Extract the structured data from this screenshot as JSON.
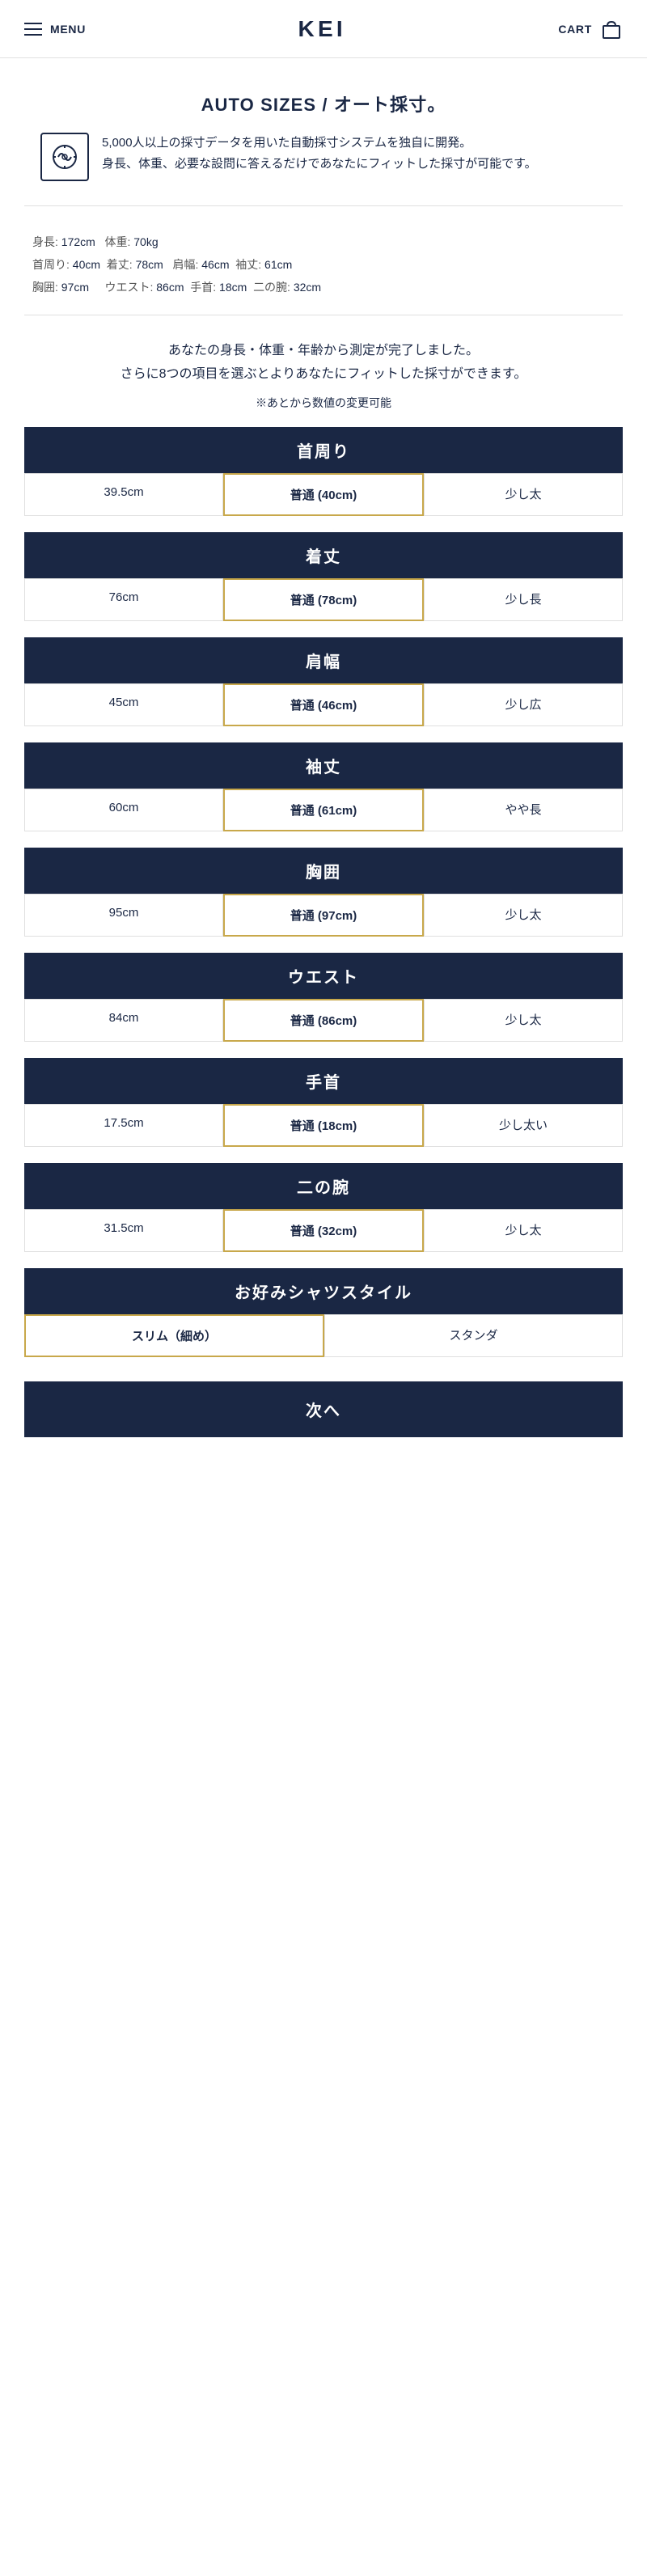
{
  "header": {
    "menu_label": "MENU",
    "logo": "KEI",
    "cart_label": "CART"
  },
  "auto_sizes": {
    "title": "AUTO SIZES / オート採寸。",
    "description_line1": "5,000人以上の採寸データを用いた自動採寸システムを独自に開発。",
    "description_line2": "身長、体重、必要な設問に答えるだけであなたにフィットした採寸が可能です。"
  },
  "measurements": {
    "rows": [
      [
        {
          "label": "身長:",
          "value": "172cm"
        },
        {
          "label": "体重:",
          "value": "70kg"
        }
      ],
      [
        {
          "label": "首周り:",
          "value": "40cm"
        },
        {
          "label": "着丈:",
          "value": "78cm"
        },
        {
          "label": "肩幅:",
          "value": "46cm"
        },
        {
          "label": "袖丈:",
          "value": "61cm"
        }
      ],
      [
        {
          "label": "胸囲:",
          "value": "97cm"
        },
        {
          "label": "ウエスト:",
          "value": "86cm"
        },
        {
          "label": "手首:",
          "value": "18cm"
        },
        {
          "label": "二の腕:",
          "value": "32cm"
        }
      ]
    ]
  },
  "intro": {
    "line1": "あなたの身長・体重・年齢から測定が完了しました。",
    "line2": "さらに8つの項目を選ぶとよりあなたにフィットした採寸ができます。",
    "note": "※あとから数値の変更可能"
  },
  "selectors": [
    {
      "id": "neck",
      "label": "首周り",
      "options": [
        {
          "text": "39.5cm",
          "selected": false
        },
        {
          "text": "普通 (40cm)",
          "selected": true
        },
        {
          "text": "少し太",
          "selected": false
        }
      ]
    },
    {
      "id": "length",
      "label": "着丈",
      "options": [
        {
          "text": "76cm",
          "selected": false
        },
        {
          "text": "普通 (78cm)",
          "selected": true
        },
        {
          "text": "少し長",
          "selected": false
        }
      ]
    },
    {
      "id": "shoulder",
      "label": "肩幅",
      "options": [
        {
          "text": "45cm",
          "selected": false
        },
        {
          "text": "普通 (46cm)",
          "selected": true
        },
        {
          "text": "少し広",
          "selected": false
        }
      ]
    },
    {
      "id": "sleeve",
      "label": "袖丈",
      "options": [
        {
          "text": "60cm",
          "selected": false
        },
        {
          "text": "普通 (61cm)",
          "selected": true
        },
        {
          "text": "やや長",
          "selected": false
        }
      ]
    },
    {
      "id": "chest",
      "label": "胸囲",
      "options": [
        {
          "text": "95cm",
          "selected": false
        },
        {
          "text": "普通 (97cm)",
          "selected": true
        },
        {
          "text": "少し太",
          "selected": false
        }
      ]
    },
    {
      "id": "waist",
      "label": "ウエスト",
      "options": [
        {
          "text": "84cm",
          "selected": false
        },
        {
          "text": "普通 (86cm)",
          "selected": true
        },
        {
          "text": "少し太",
          "selected": false
        }
      ]
    },
    {
      "id": "wrist",
      "label": "手首",
      "options": [
        {
          "text": "17.5cm",
          "selected": false
        },
        {
          "text": "普通 (18cm)",
          "selected": true
        },
        {
          "text": "少し太い",
          "selected": false
        }
      ]
    },
    {
      "id": "upper_arm",
      "label": "二の腕",
      "options": [
        {
          "text": "31.5cm",
          "selected": false
        },
        {
          "text": "普通 (32cm)",
          "selected": true
        },
        {
          "text": "少し太",
          "selected": false
        }
      ]
    },
    {
      "id": "style",
      "label": "お好みシャツスタイル",
      "options": [
        {
          "text": "スリム（細め）",
          "selected": true
        },
        {
          "text": "スタンダ",
          "selected": false
        }
      ]
    }
  ],
  "next_button": {
    "label": "次へ"
  }
}
